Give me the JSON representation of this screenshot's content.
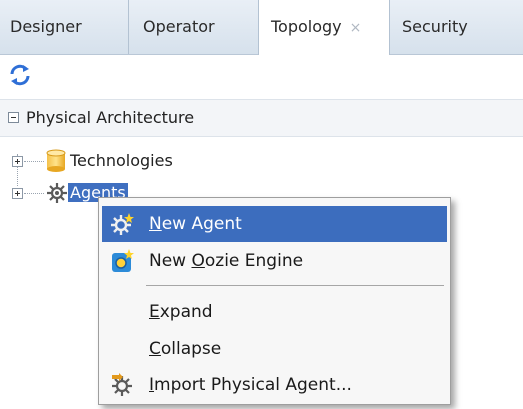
{
  "tabs": [
    {
      "label": "Designer"
    },
    {
      "label": "Operator"
    },
    {
      "label": "Topology",
      "close": "×"
    },
    {
      "label": "Security"
    }
  ],
  "section": {
    "label": "Physical Architecture"
  },
  "tree": {
    "technologies": "Technologies",
    "agents": "Agents"
  },
  "menu": {
    "items": [
      {
        "mnemonic": "N",
        "rest": "ew Agent",
        "icon": "new-agent-icon"
      },
      {
        "pre": "New ",
        "mnemonic": "O",
        "rest": "ozie Engine",
        "icon": "oozie-engine-icon"
      },
      {
        "mnemonic": "E",
        "rest": "xpand"
      },
      {
        "mnemonic": "C",
        "rest": "ollapse"
      },
      {
        "mnemonic": "I",
        "rest": "mport Physical Agent...",
        "icon": "import-agent-icon"
      }
    ]
  },
  "colors": {
    "selection": "#3c6dbe",
    "tabbar": "#dfe8f2"
  }
}
